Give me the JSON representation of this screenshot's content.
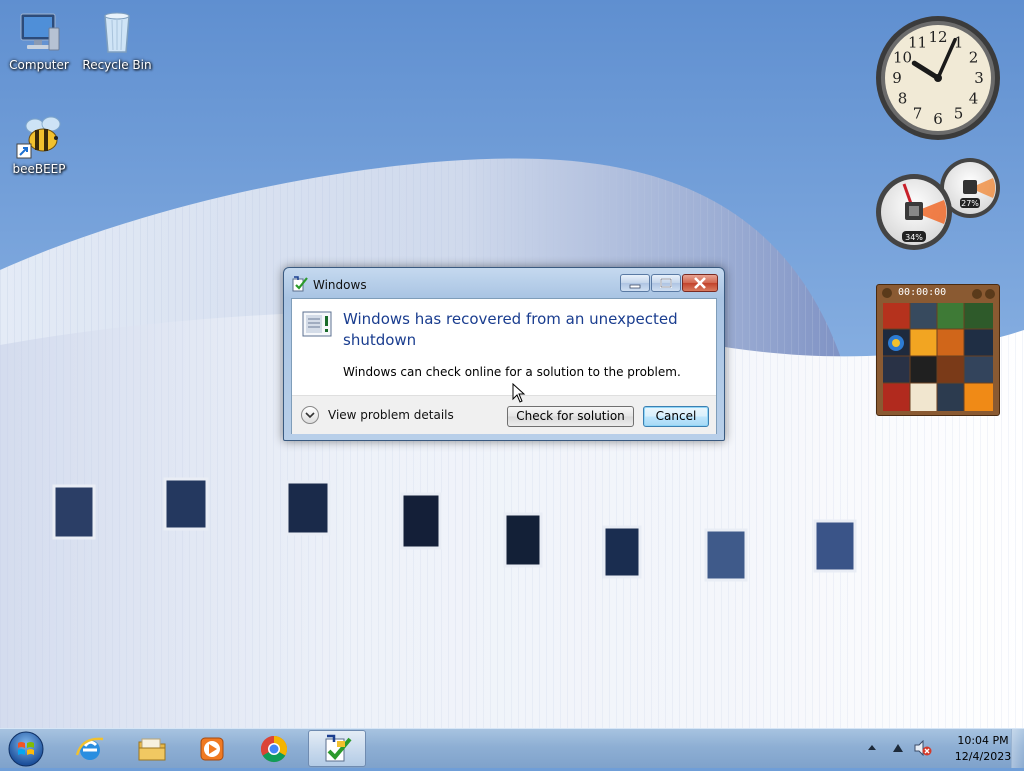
{
  "desktop": {
    "icons": [
      {
        "label": "Computer",
        "icon": "computer-icon"
      },
      {
        "label": "Recycle Bin",
        "icon": "recycle-bin-icon"
      },
      {
        "label": "beeBEEP",
        "icon": "beebeep-icon"
      }
    ]
  },
  "gadgets": {
    "clock": {
      "numbers": [
        "12",
        "1",
        "2",
        "3",
        "4",
        "5",
        "6",
        "7",
        "8",
        "9",
        "10",
        "11"
      ],
      "hour": 10,
      "minute": 4
    },
    "cpu_meter": {
      "cpu_label": "34%",
      "memory_label": "27%",
      "cpu_value": 34,
      "memory_value": 27
    },
    "puzzle": {
      "timer": "00:00:00"
    }
  },
  "dialog": {
    "title": "Windows",
    "heading": "Windows has recovered from an unexpected shutdown",
    "message": "Windows can check online for a solution to the problem.",
    "details_label": "View problem details",
    "check_button": "Check for solution",
    "cancel_button": "Cancel"
  },
  "taskbar": {
    "pinned": [
      {
        "icon": "internet-explorer-icon"
      },
      {
        "icon": "file-explorer-icon"
      },
      {
        "icon": "media-player-icon"
      },
      {
        "icon": "chrome-icon"
      },
      {
        "icon": "problem-reports-icon",
        "active": true
      }
    ],
    "clock_time": "10:04 PM",
    "clock_date": "12/4/2023"
  },
  "colors": {
    "sky": "#6f9ed8",
    "dialog_heading": "#1a3d8f",
    "taskbar": "#8eafd4"
  }
}
